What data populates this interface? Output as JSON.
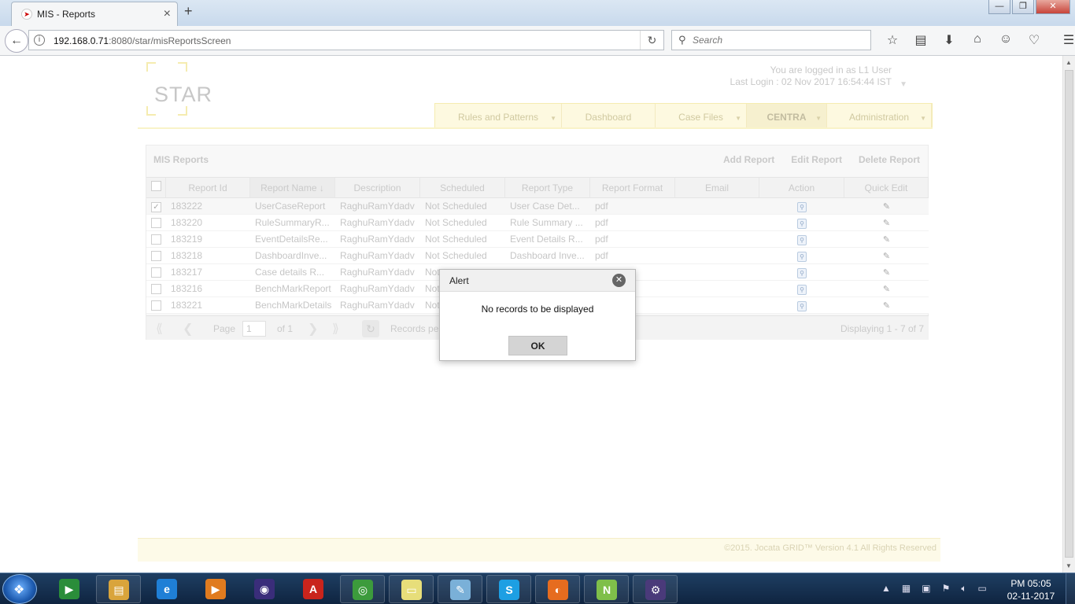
{
  "browser": {
    "tab_title": "MIS - Reports",
    "url_host": "192.168.0.71",
    "url_rest": ":8080/star/misReportsScreen",
    "search_placeholder": "Search"
  },
  "header": {
    "logo_text": "STAR",
    "logged_in": "You are logged in as L1 User",
    "last_login": "Last Login : 02 Nov 2017 16:54:44 IST"
  },
  "menu": [
    {
      "label": "Rules and Patterns",
      "width": 161,
      "caret": true
    },
    {
      "label": "Dashboard",
      "width": 119,
      "caret": false
    },
    {
      "label": "Case Files",
      "width": 116,
      "caret": true
    },
    {
      "label": "CENTRA",
      "width": 102,
      "caret": true,
      "active": true
    },
    {
      "label": "Administration",
      "width": 133,
      "caret": true
    }
  ],
  "panel": {
    "title": "MIS Reports",
    "actions": [
      "Add Report",
      "Edit Report",
      "Delete Report"
    ]
  },
  "grid": {
    "headers": [
      "Report Id",
      "Report Name",
      "Description",
      "Scheduled",
      "Report Type",
      "Report Format",
      "Email",
      "Action",
      "Quick Edit"
    ],
    "sort_arrow": "↓",
    "rows": [
      {
        "id": "183222",
        "name": "UserCaseReport",
        "desc": "RaghuRamYdadv",
        "sched": "Not Scheduled",
        "type": "User Case Det...",
        "format": "pdf",
        "email": "",
        "checked": true
      },
      {
        "id": "183220",
        "name": "RuleSummaryR...",
        "desc": "RaghuRamYdadv",
        "sched": "Not Scheduled",
        "type": "Rule Summary ...",
        "format": "pdf",
        "email": "",
        "checked": false
      },
      {
        "id": "183219",
        "name": "EventDetailsRe...",
        "desc": "RaghuRamYdadv",
        "sched": "Not Scheduled",
        "type": "Event Details R...",
        "format": "pdf",
        "email": "",
        "checked": false
      },
      {
        "id": "183218",
        "name": "DashboardInve...",
        "desc": "RaghuRamYdadv",
        "sched": "Not Scheduled",
        "type": "Dashboard Inve...",
        "format": "pdf",
        "email": "",
        "checked": false
      },
      {
        "id": "183217",
        "name": "Case details R...",
        "desc": "RaghuRamYdadv",
        "sched": "Not",
        "type": "",
        "format": "",
        "email": "",
        "checked": false
      },
      {
        "id": "183216",
        "name": "BenchMarkReport",
        "desc": "RaghuRamYdadv",
        "sched": "Not",
        "type": "",
        "format": "",
        "email": "",
        "checked": false
      },
      {
        "id": "183221",
        "name": "BenchMarkDetails",
        "desc": "RaghuRamYdadv",
        "sched": "Not",
        "type": "",
        "format": "",
        "email": "",
        "checked": false
      }
    ]
  },
  "pager": {
    "page_label": "Page",
    "page_value": "1",
    "of_label": "of 1",
    "records_label": "Records pe",
    "displaying": "Displaying 1 - 7 of 7"
  },
  "footer": {
    "text": "©2015. Jocata GRID™ Version 4.1 All Rights Reserved"
  },
  "alert": {
    "title": "Alert",
    "message": "No records to be displayed",
    "ok_label": "OK"
  },
  "taskbar": {
    "time": "PM 05:05",
    "date": "02-11-2017",
    "items": [
      {
        "name": "media-center-icon",
        "glyph": "▶",
        "color": "#2a8d3a",
        "pinned": false
      },
      {
        "name": "file-explorer-icon",
        "glyph": "▤",
        "color": "#d9a43b",
        "pinned": true
      },
      {
        "name": "internet-explorer-icon",
        "glyph": "e",
        "color": "#1f7fd6",
        "pinned": false
      },
      {
        "name": "media-player-icon",
        "glyph": "▶",
        "color": "#e07b1f",
        "pinned": false
      },
      {
        "name": "eclipse-icon",
        "glyph": "◉",
        "color": "#3a2d7a",
        "pinned": false
      },
      {
        "name": "acrobat-icon",
        "glyph": "A",
        "color": "#c9241c",
        "pinned": false
      },
      {
        "name": "chrome-icon",
        "glyph": "◎",
        "color": "#3c9b3c",
        "pinned": true
      },
      {
        "name": "sticky-notes-icon",
        "glyph": "▭",
        "color": "#e7de7a",
        "pinned": true
      },
      {
        "name": "notepad-icon",
        "glyph": "✎",
        "color": "#7ab0d8",
        "pinned": true
      },
      {
        "name": "skype-icon",
        "glyph": "S",
        "color": "#1d9fe3",
        "pinned": true
      },
      {
        "name": "firefox-icon",
        "glyph": "◐",
        "color": "#e66c1f",
        "pinned": true
      },
      {
        "name": "notepadpp-icon",
        "glyph": "N",
        "color": "#7fbf4a",
        "pinned": true
      },
      {
        "name": "java-ee-ide-icon",
        "glyph": "⚙",
        "color": "#4a3a7a",
        "pinned": true
      }
    ]
  }
}
